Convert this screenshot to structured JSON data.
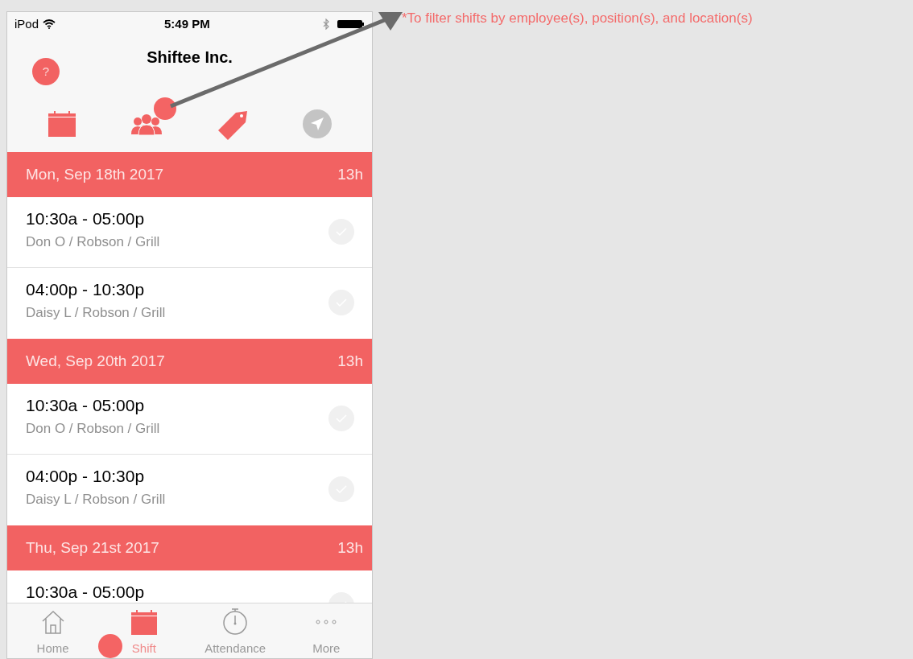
{
  "annotation": "*To filter shifts by employee(s), position(s), and location(s)",
  "status_bar": {
    "carrier": "iPod",
    "time": "5:49 PM"
  },
  "header": {
    "title": "Shiftee Inc.",
    "help": "?"
  },
  "filters": [
    {
      "kind": "calendar",
      "active": true
    },
    {
      "kind": "people",
      "active": true
    },
    {
      "kind": "tag",
      "active": true
    },
    {
      "kind": "location",
      "active": false
    }
  ],
  "days": [
    {
      "date": "Mon, Sep 18th 2017",
      "hours": "13h",
      "shifts": [
        {
          "time": "10:30a - 05:00p",
          "detail": "Don O / Robson / Grill",
          "checked": false
        },
        {
          "time": "04:00p - 10:30p",
          "detail": "Daisy L / Robson / Grill",
          "checked": false
        }
      ]
    },
    {
      "date": "Wed, Sep 20th 2017",
      "hours": "13h",
      "shifts": [
        {
          "time": "10:30a - 05:00p",
          "detail": "Don O / Robson / Grill",
          "checked": false
        },
        {
          "time": "04:00p - 10:30p",
          "detail": "Daisy L / Robson / Grill",
          "checked": false
        }
      ]
    },
    {
      "date": "Thu, Sep 21st 2017",
      "hours": "13h",
      "shifts": [
        {
          "time": "10:30a - 05:00p",
          "checked": false
        }
      ]
    }
  ],
  "tabs": [
    {
      "label": "Home",
      "kind": "home",
      "selected": false
    },
    {
      "label": "Shift",
      "kind": "calendar",
      "selected": true
    },
    {
      "label": "Attendance",
      "kind": "stopwatch",
      "selected": false
    },
    {
      "label": "More",
      "kind": "more",
      "selected": false
    }
  ]
}
